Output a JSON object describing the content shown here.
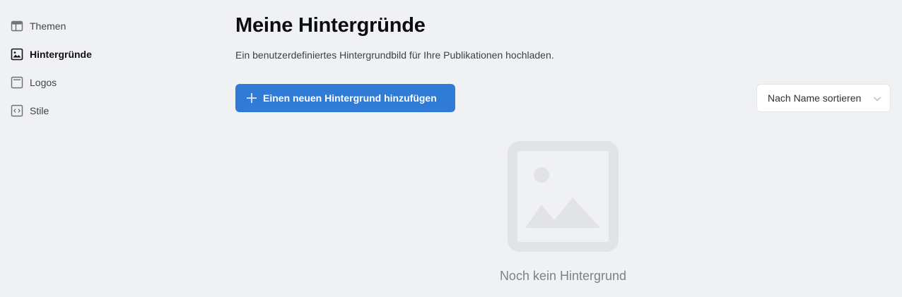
{
  "sidebar": {
    "items": [
      {
        "label": "Themen",
        "icon": "layout-icon",
        "active": false
      },
      {
        "label": "Hintergründe",
        "icon": "image-icon",
        "active": true
      },
      {
        "label": "Logos",
        "icon": "logo-frame-icon",
        "active": false
      },
      {
        "label": "Stile",
        "icon": "code-icon",
        "active": false
      }
    ]
  },
  "main": {
    "title": "Meine Hintergründe",
    "subtitle": "Ein benutzerdefiniertes Hintergrundbild für Ihre Publikationen hochladen.",
    "add_button_label": "Einen neuen Hintergrund hinzufügen",
    "sort": {
      "selected": "Nach Name sortieren"
    },
    "empty_state": {
      "text": "Noch kein Hintergrund",
      "icon": "image-placeholder-icon"
    }
  },
  "colors": {
    "background": "#f0f1f3",
    "accent": "#2f7bd6",
    "placeholder": "#e2e3e5"
  }
}
